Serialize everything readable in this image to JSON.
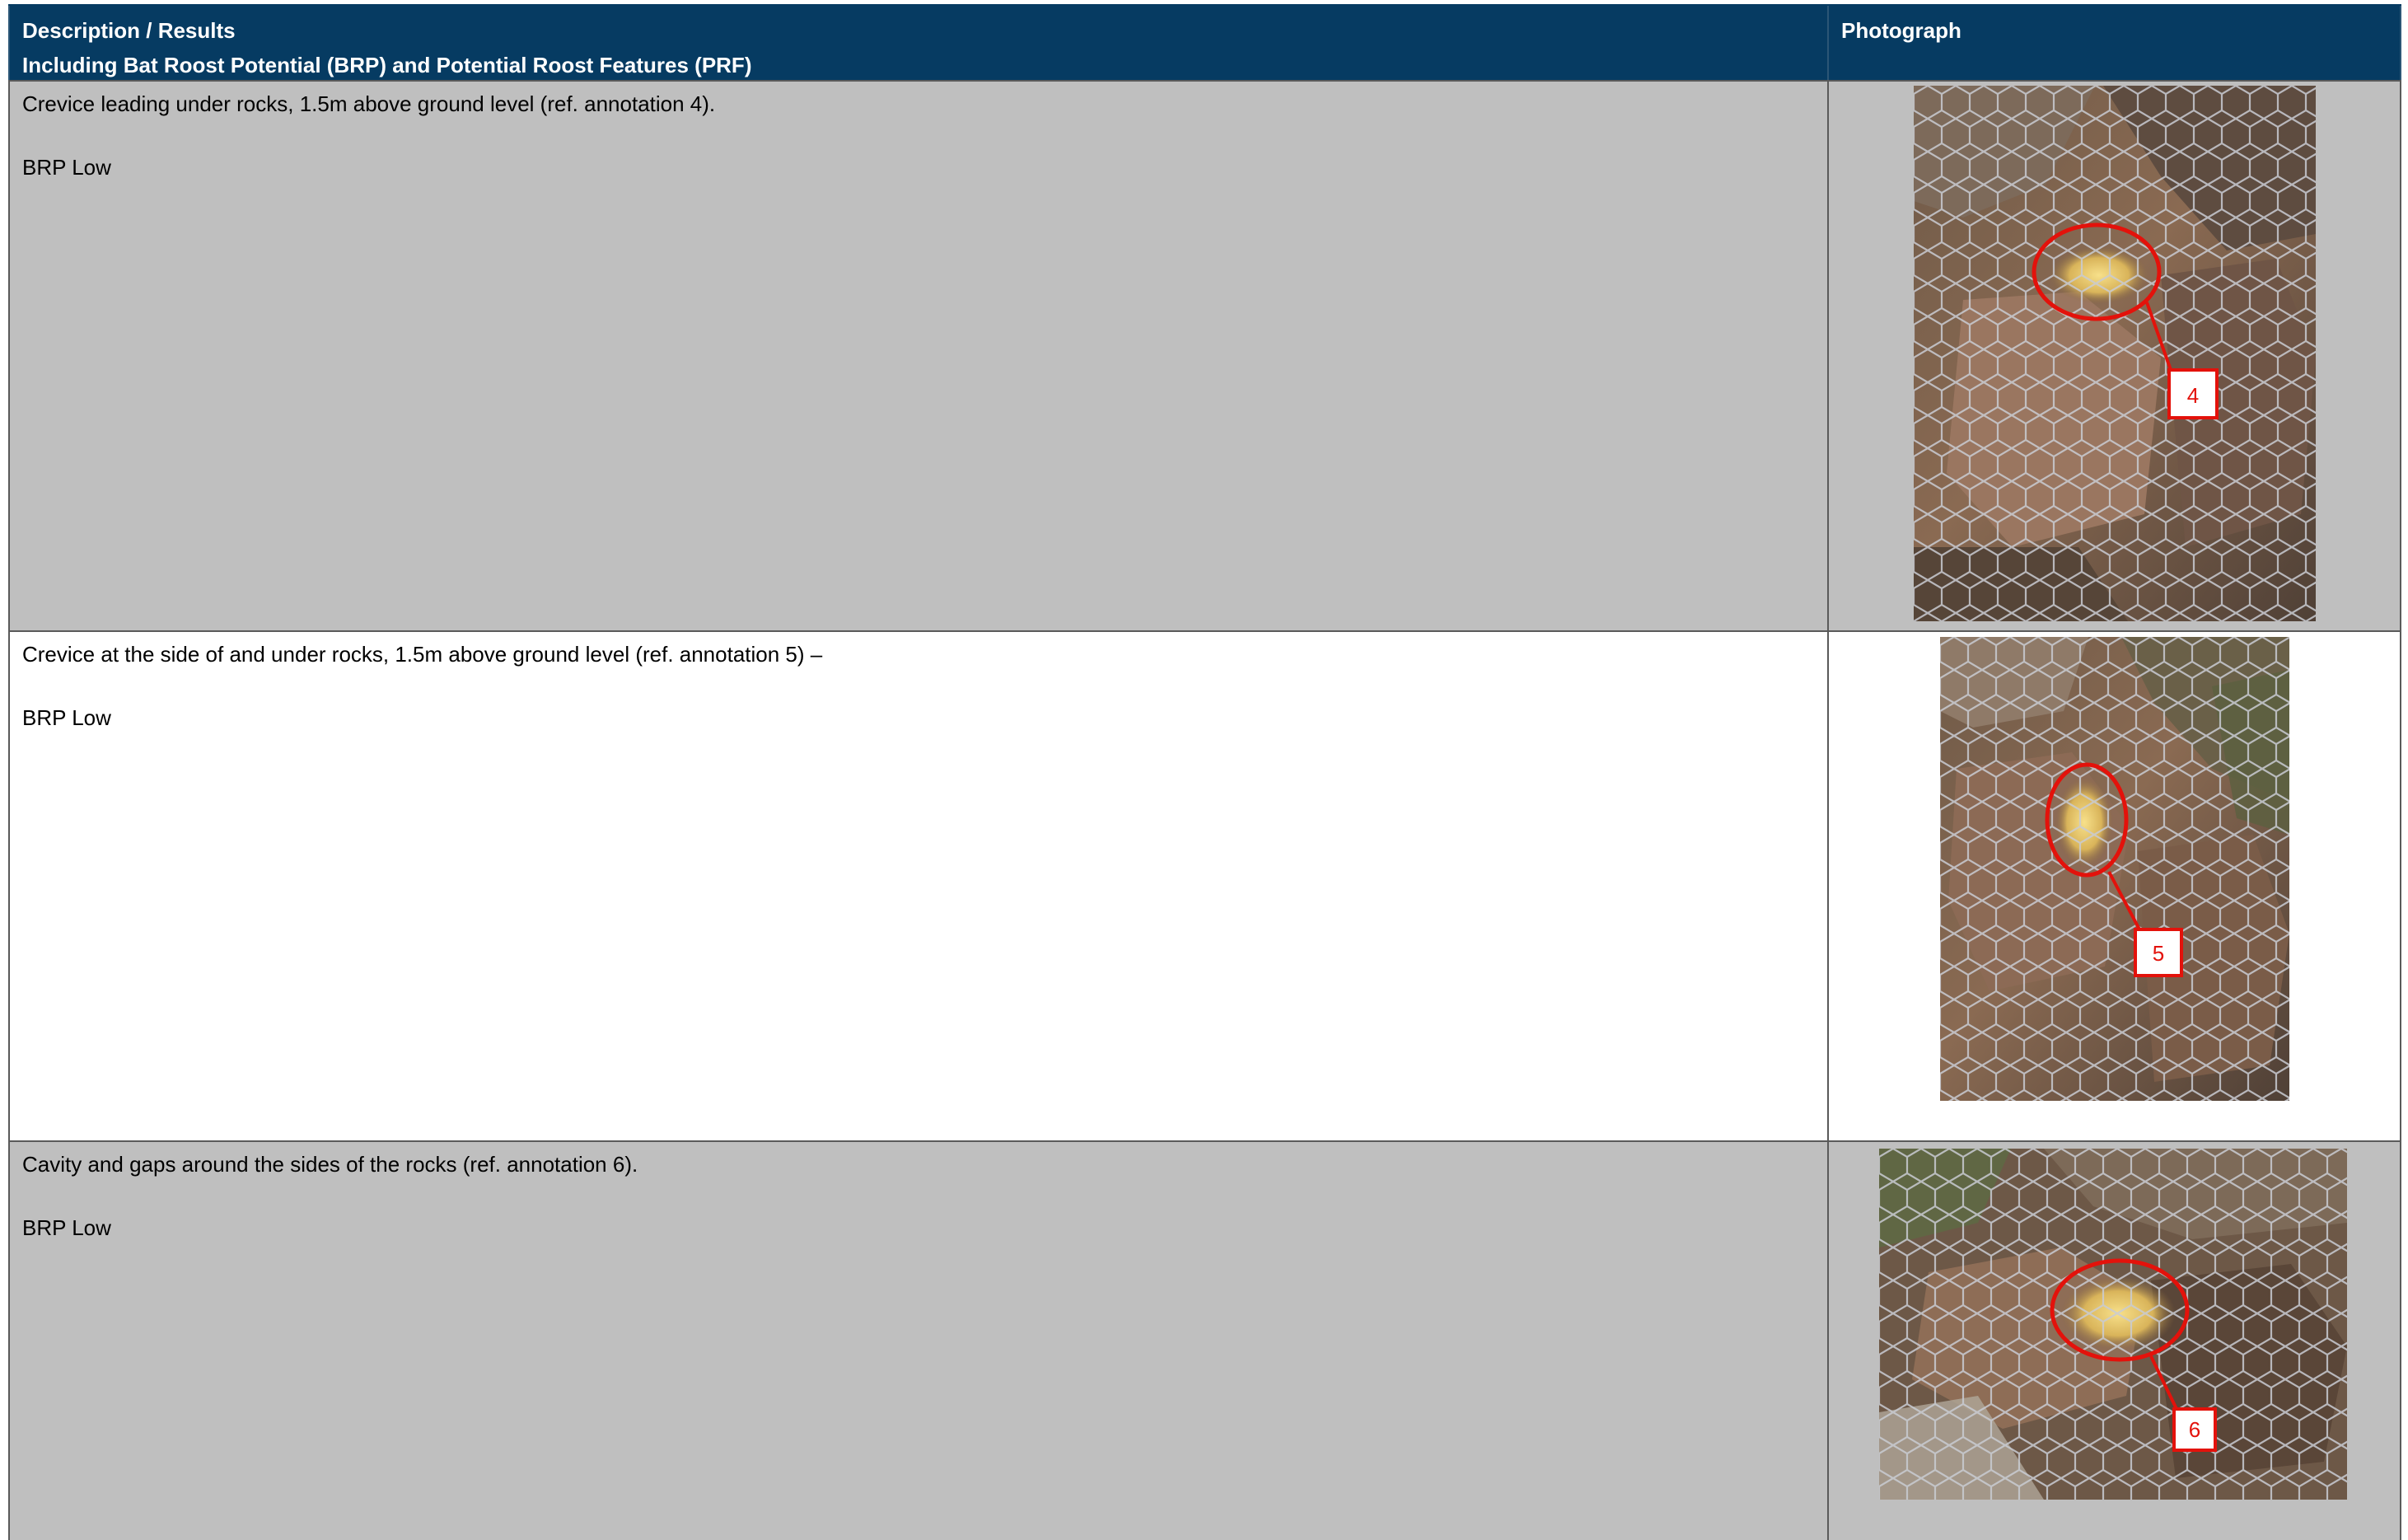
{
  "header": {
    "description_line1": "Description / Results",
    "description_line2": "Including Bat Roost Potential (BRP) and Potential Roost Features (PRF)",
    "photograph": "Photograph"
  },
  "rows": [
    {
      "description": "Crevice leading under rocks, 1.5m above ground level (ref. annotation 4).",
      "brp": "BRP Low",
      "annotation": "4"
    },
    {
      "description": "Crevice at the side of and under rocks, 1.5m above ground level (ref. annotation 5) –",
      "brp": "BRP Low",
      "annotation": "5"
    },
    {
      "description": "Cavity and gaps around the sides of the rocks (ref. annotation 6).",
      "brp": "BRP Low",
      "annotation": "6"
    }
  ],
  "colors": {
    "header_bg": "#063b62",
    "row_gray": "#bfbfbf",
    "annotation_red": "#e3120b"
  }
}
